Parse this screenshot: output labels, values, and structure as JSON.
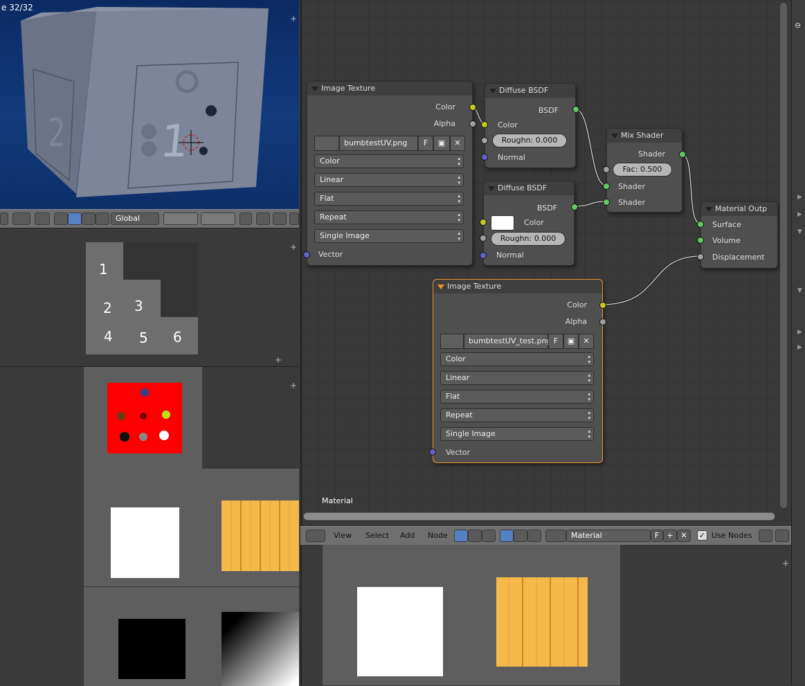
{
  "viewport": {
    "status_text": "e 32/32",
    "orientation": "Global",
    "face_numbers": [
      "1",
      "2"
    ]
  },
  "uv_panel": {
    "numbers": [
      "1",
      "2",
      "3",
      "4",
      "5",
      "6"
    ]
  },
  "node_editor": {
    "footer_label": "Material",
    "nodes": {
      "image_texture_1": {
        "title": "Image Texture",
        "out_color": "Color",
        "out_alpha": "Alpha",
        "image_name": "bumbtestUV.png",
        "fake_user": "F",
        "dropdowns": [
          "Color",
          "Linear",
          "Flat",
          "Repeat",
          "Single Image"
        ],
        "in_vector": "Vector"
      },
      "diffuse_1": {
        "title": "Diffuse BSDF",
        "out_bsdf": "BSDF",
        "in_color": "Color",
        "roughness": "Roughn: 0.000",
        "in_normal": "Normal"
      },
      "diffuse_2": {
        "title": "Diffuse BSDF",
        "out_bsdf": "BSDF",
        "in_color": "Color",
        "roughness": "Roughn: 0.000",
        "in_normal": "Normal"
      },
      "mix_shader": {
        "title": "Mix Shader",
        "out_shader": "Shader",
        "fac": "Fac: 0.500",
        "in_shader_1": "Shader",
        "in_shader_2": "Shader"
      },
      "material_output": {
        "title": "Material Outp",
        "in_surface": "Surface",
        "in_volume": "Volume",
        "in_displacement": "Displacement"
      },
      "image_texture_2": {
        "title": "Image Texture",
        "out_color": "Color",
        "out_alpha": "Alpha",
        "image_name": "bumbtestUV_test.png",
        "fake_user": "F",
        "dropdowns": [
          "Color",
          "Linear",
          "Flat",
          "Repeat",
          "Single Image"
        ],
        "in_vector": "Vector"
      }
    }
  },
  "node_header": {
    "menus": [
      "View",
      "Select",
      "Add",
      "Node"
    ],
    "material_name": "Material",
    "fake_user": "F",
    "use_nodes_label": "Use Nodes",
    "use_nodes_checked": true
  },
  "colors": {
    "socket_color": "#c7c729",
    "socket_float": "#a1a1a1",
    "socket_vector": "#6363c7",
    "socket_shader": "#63c763",
    "active_node_border": "#e8942d",
    "viewport_bg": "#0d2f68"
  }
}
